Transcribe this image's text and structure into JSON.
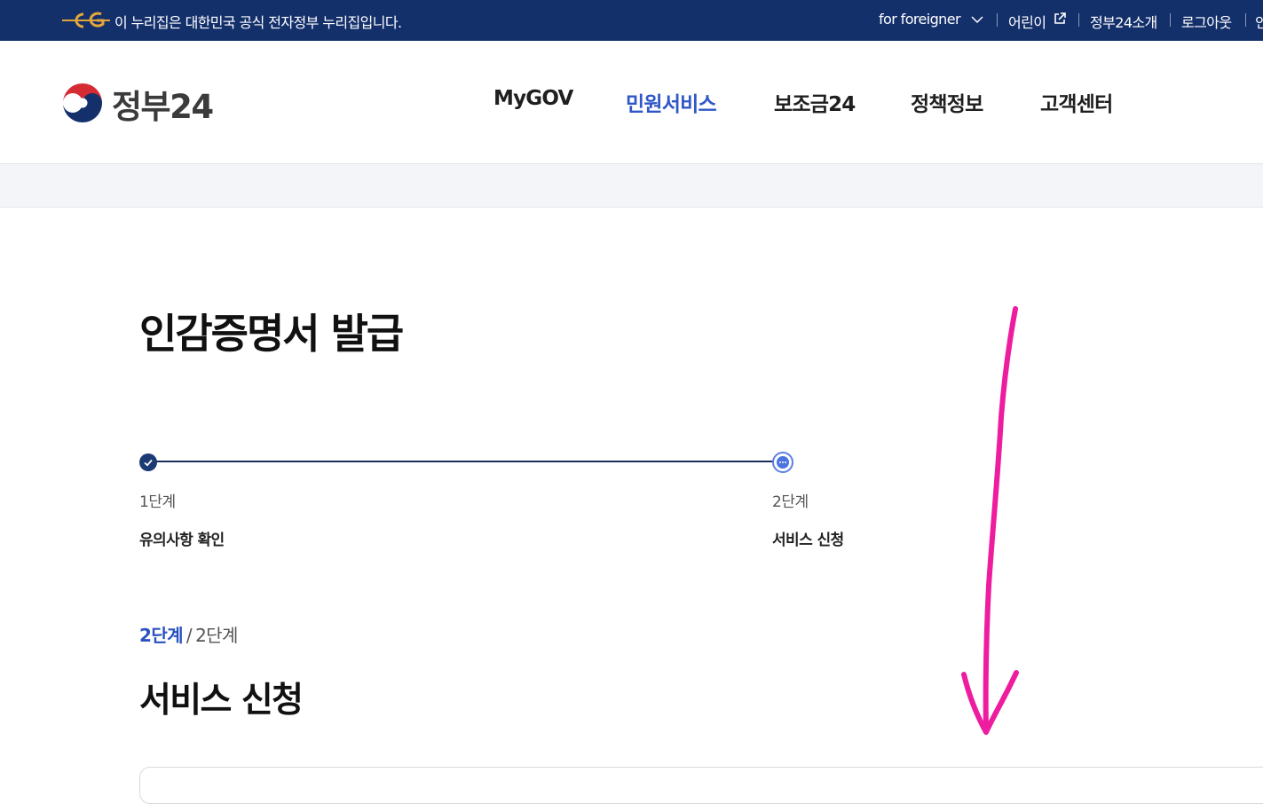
{
  "banner": {
    "official_notice": "이 누리집은 대한민국 공식 전자정부 누리집입니다.",
    "links": {
      "foreigner": "for foreigner",
      "kids": "어린이",
      "about": "정부24소개",
      "logout": "로그아웃",
      "partial": "인"
    },
    "background_color": "#14306b"
  },
  "header": {
    "brand": "정부24",
    "nav": [
      "MyGOV",
      "민원서비스",
      "보조금24",
      "정책정보",
      "고객센터"
    ],
    "active_nav": "민원서비스",
    "accent_color": "#2f57c8"
  },
  "page": {
    "title": "인감증명서 발급"
  },
  "stepper": {
    "steps": [
      {
        "number": "1단계",
        "label": "유의사항 확인",
        "state": "completed"
      },
      {
        "number": "2단계",
        "label": "서비스 신청",
        "state": "current"
      }
    ]
  },
  "progress": {
    "current": "2단계",
    "separator": "/",
    "total": "2단계"
  },
  "section": {
    "title": "서비스 신청"
  },
  "annotation": {
    "icon": "arrow-down-icon",
    "color": "#ee1c9e"
  }
}
